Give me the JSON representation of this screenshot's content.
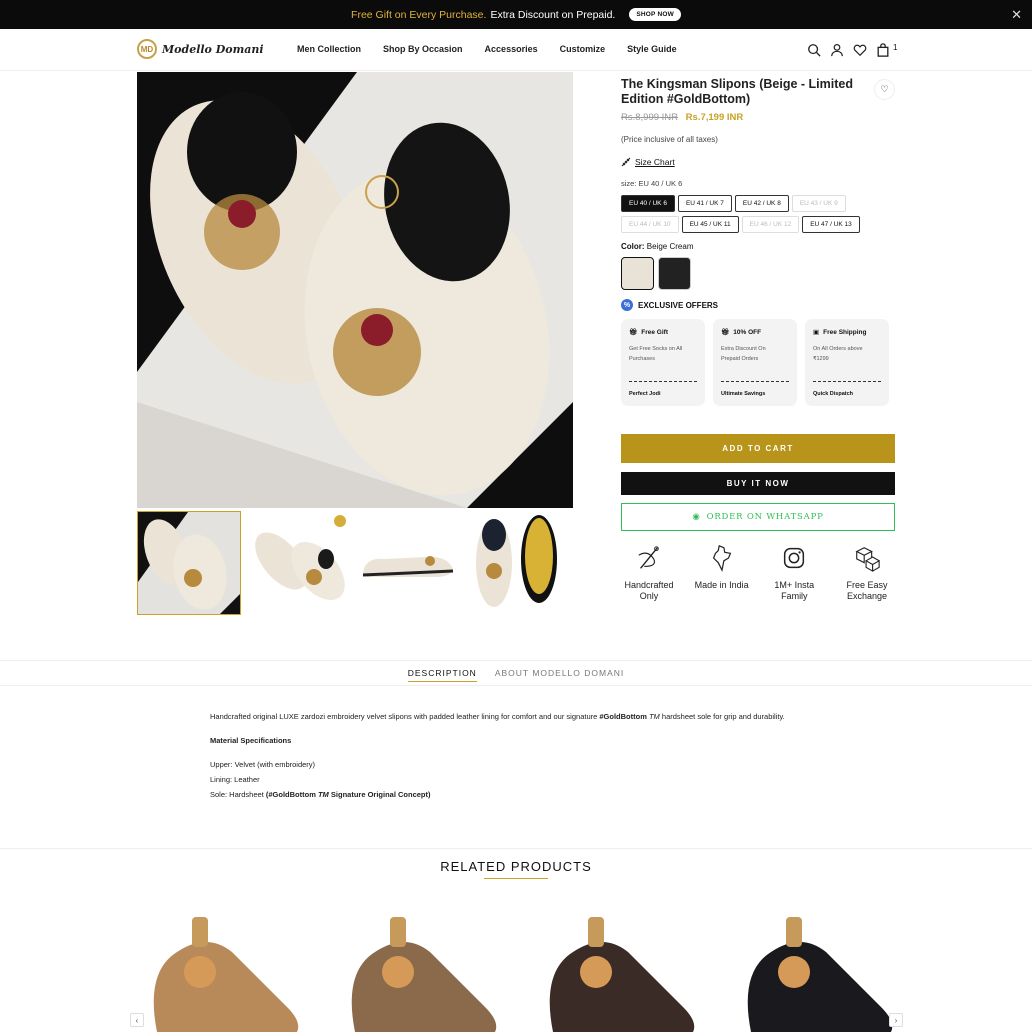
{
  "announcement": {
    "gold_text": "Free Gift on Every Purchase.",
    "white_text": "Extra Discount on Prepaid.",
    "button": "SHOP NOW",
    "close_icon": "close-icon"
  },
  "header": {
    "logo_text": "Modello Domani",
    "logo_mark": "MD",
    "nav": [
      "Men Collection",
      "Shop By Occasion",
      "Accessories",
      "Customize",
      "Style Guide"
    ],
    "cart_count": "1"
  },
  "product": {
    "title": "The Kingsman Slipons (Beige - Limited Edition #GoldBottom)",
    "old_price": "Rs.8,999 INR",
    "new_price": "Rs.7,199 INR",
    "tax_note": "(Price inclusive of all taxes)",
    "size_chart": "Size Chart",
    "size_label": "size: EU 40 / UK 6",
    "sizes": [
      {
        "label": "EU 40 / UK 6",
        "state": "active"
      },
      {
        "label": "EU 41 / UK 7",
        "state": "normal"
      },
      {
        "label": "EU 42 / UK 8",
        "state": "normal"
      },
      {
        "label": "EU 43 / UK 9",
        "state": "disabled"
      },
      {
        "label": "EU 44 / UK 10",
        "state": "disabled"
      },
      {
        "label": "EU 45 / UK 11",
        "state": "normal"
      },
      {
        "label": "EU 46 / UK 12",
        "state": "disabled"
      },
      {
        "label": "EU 47 / UK 13",
        "state": "normal"
      }
    ],
    "color_label": "Color:",
    "color_value": "Beige Cream",
    "offers_heading": "EXCLUSIVE OFFERS",
    "offers": [
      {
        "title": "Free Gift",
        "desc": "Get Free Socks on All Purchases",
        "footer": "Perfect Jodi"
      },
      {
        "title": "10% OFF",
        "desc": "Extra Discount On Prepaid Orders",
        "footer": "Ultimate Savings"
      },
      {
        "title": "Free Shipping",
        "desc": "On All Orders above ₹1299",
        "footer": "Quick Dispatch"
      }
    ],
    "add_to_cart": "ADD TO CART",
    "buy_now": "BUY IT NOW",
    "whatsapp": "ORDER ON WHATSAPP",
    "features": [
      {
        "icon": "needle-thread-icon",
        "label": "Handcrafted Only"
      },
      {
        "icon": "india-map-icon",
        "label": "Made in India"
      },
      {
        "icon": "instagram-icon",
        "label": "1M+ Insta Family"
      },
      {
        "icon": "exchange-boxes-icon",
        "label": "Free Easy Exchange"
      }
    ]
  },
  "tabs": [
    "DESCRIPTION",
    "ABOUT MODELLO DOMANI"
  ],
  "description": {
    "intro_start": "Handcrafted original LUXE zardozi embroidery velvet slipons with padded leather lining for comfort and our signature ",
    "intro_bold": "#GoldBottom",
    "intro_tm": "TM",
    "intro_end": " hardsheet sole for grip and durability.",
    "spec_heading": "Material Specifications",
    "upper": "Upper: Velvet (with embroidery)",
    "lining": "Lining: Leather",
    "sole_start": "Sole: Hardsheet ",
    "sole_bold": "(#GoldBottom",
    "sole_tm": "TM",
    "sole_end": " Signature Original Concept)"
  },
  "related": {
    "heading": "RELATED PRODUCTS",
    "products": [
      {
        "color": "#b88a5a"
      },
      {
        "color": "#8a6a4a"
      },
      {
        "color": "#3a2b26"
      },
      {
        "color": "#1a1a1e"
      }
    ]
  },
  "colors": {
    "gold": "#b9941b",
    "whatsapp_green": "#2fbf55"
  }
}
